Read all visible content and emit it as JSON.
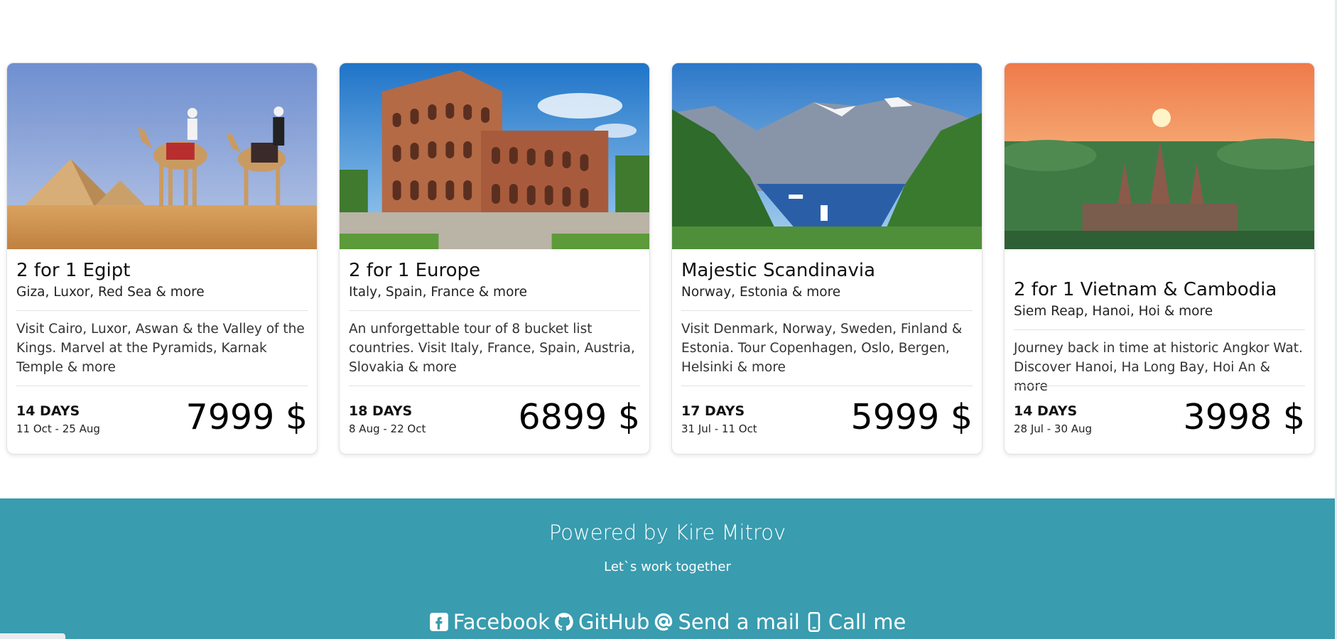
{
  "tours": [
    {
      "title": "2 for 1 Egipt",
      "subtitle": "Giza, Luxor, Red Sea & more",
      "description": "Visit Cairo, Luxor, Aswan & the Valley of the Kings. Marvel at the Pyramids, Karnak Temple & more",
      "days": "14 DAYS",
      "dates": "11 Oct - 25 Aug",
      "price": "7999 $"
    },
    {
      "title": "2 for 1 Europe",
      "subtitle": "Italy, Spain, France & more",
      "description": "An unforgettable tour of 8 bucket list countries. Visit Italy, France, Spain, Austria, Slovakia & more",
      "days": "18 DAYS",
      "dates": "8 Aug - 22 Oct",
      "price": "6899 $"
    },
    {
      "title": "Majestic Scandinavia",
      "subtitle": "Norway, Estonia & more",
      "description": "Visit Denmark, Norway, Sweden, Finland & Estonia. Tour Copenhagen, Oslo, Bergen, Helsinki & more",
      "days": "17 DAYS",
      "dates": "31 Jul - 11 Oct",
      "price": "5999 $"
    },
    {
      "title": "2 for 1 Vietnam & Cambodia",
      "subtitle": "Siem Reap, Hanoi, Hoi & more",
      "description": "Journey back in time at historic Angkor Wat. Discover Hanoi, Ha Long Bay, Hoi An & more",
      "days": "14 DAYS",
      "dates": "28 Jul - 30 Aug",
      "price": "3998 $"
    }
  ],
  "footer": {
    "powered": "Powered by Kire Mitrov",
    "tagline": "Let`s work together",
    "links": [
      {
        "label": "Facebook",
        "icon": "facebook-icon"
      },
      {
        "label": "GitHub",
        "icon": "github-icon"
      },
      {
        "label": "Send a mail",
        "icon": "at-icon"
      },
      {
        "label": "Call me",
        "icon": "phone-icon"
      }
    ],
    "accent": "#399caf"
  }
}
